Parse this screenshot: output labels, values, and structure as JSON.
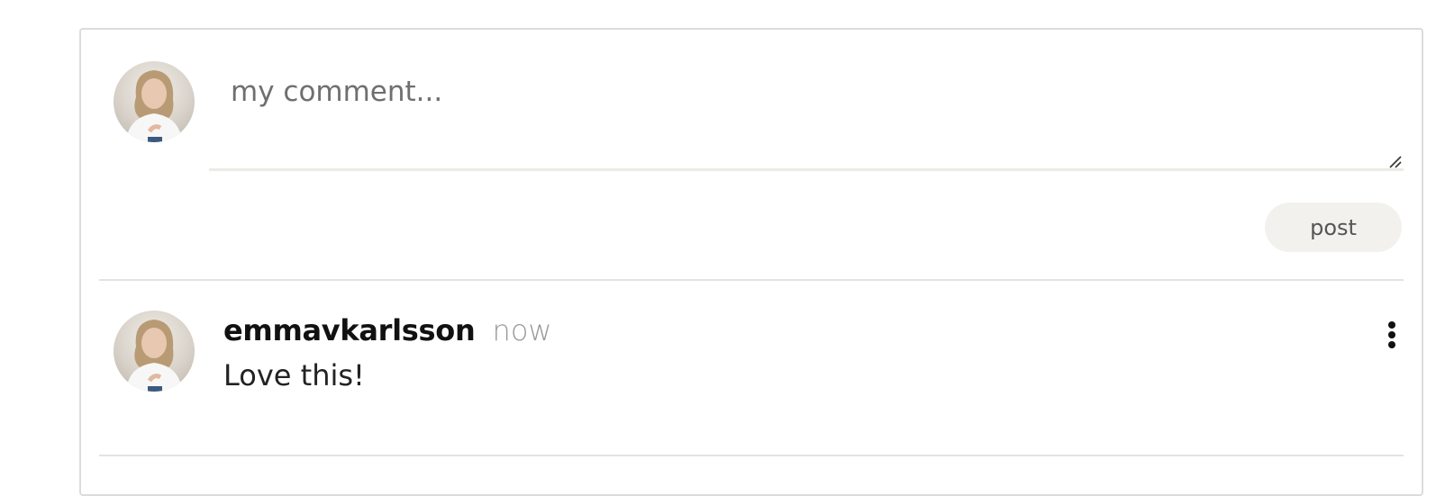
{
  "composer": {
    "placeholder": "my comment...",
    "post_label": "post"
  },
  "comments": [
    {
      "author": "emmavkarlsson",
      "time": "now",
      "text": "Love this!"
    }
  ],
  "icons": {
    "avatar": "user-photo-avatar",
    "resize": "resize-grip-icon",
    "more": "more-vertical-icon"
  },
  "colors": {
    "post_button_bg": "#f2f1ed",
    "divider": "#e3e3e3",
    "timestamp": "#9a9a9a"
  }
}
